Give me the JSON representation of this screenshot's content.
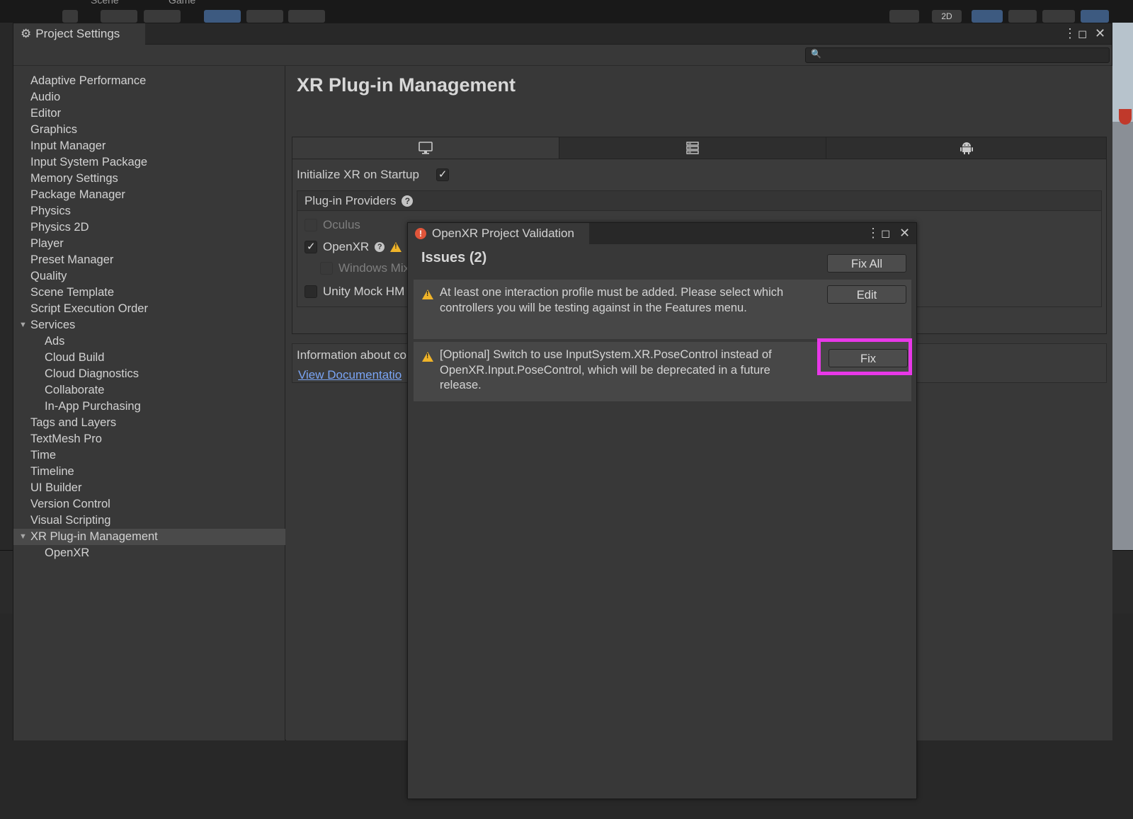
{
  "editor": {
    "tabs": [
      "Scene",
      "Game"
    ],
    "toolbar_2d": "2D"
  },
  "project_settings": {
    "title": "Project Settings",
    "search": {
      "placeholder": ""
    },
    "sidebar": [
      {
        "label": "Adaptive Performance",
        "level": 0
      },
      {
        "label": "Audio",
        "level": 0
      },
      {
        "label": "Editor",
        "level": 0
      },
      {
        "label": "Graphics",
        "level": 0
      },
      {
        "label": "Input Manager",
        "level": 0
      },
      {
        "label": "Input System Package",
        "level": 0
      },
      {
        "label": "Memory Settings",
        "level": 0
      },
      {
        "label": "Package Manager",
        "level": 0
      },
      {
        "label": "Physics",
        "level": 0
      },
      {
        "label": "Physics 2D",
        "level": 0
      },
      {
        "label": "Player",
        "level": 0
      },
      {
        "label": "Preset Manager",
        "level": 0
      },
      {
        "label": "Quality",
        "level": 0
      },
      {
        "label": "Scene Template",
        "level": 0
      },
      {
        "label": "Script Execution Order",
        "level": 0
      },
      {
        "label": "Services",
        "level": 0,
        "expanded": true
      },
      {
        "label": "Ads",
        "level": 1
      },
      {
        "label": "Cloud Build",
        "level": 1
      },
      {
        "label": "Cloud Diagnostics",
        "level": 1
      },
      {
        "label": "Collaborate",
        "level": 1
      },
      {
        "label": "In-App Purchasing",
        "level": 1
      },
      {
        "label": "Tags and Layers",
        "level": 0
      },
      {
        "label": "TextMesh Pro",
        "level": 0
      },
      {
        "label": "Time",
        "level": 0
      },
      {
        "label": "Timeline",
        "level": 0
      },
      {
        "label": "UI Builder",
        "level": 0
      },
      {
        "label": "Version Control",
        "level": 0
      },
      {
        "label": "Visual Scripting",
        "level": 0
      },
      {
        "label": "XR Plug-in Management",
        "level": 0,
        "expanded": true,
        "selected": true
      },
      {
        "label": "OpenXR",
        "level": 1
      }
    ],
    "content": {
      "title": "XR Plug-in Management",
      "platform_tabs": [
        "desktop-icon",
        "server-icon",
        "android-icon"
      ],
      "init_label": "Initialize XR on Startup",
      "init_checked": true,
      "providers_title": "Plug-in Providers",
      "providers": [
        {
          "label": "Oculus",
          "checked": false,
          "disabled": true
        },
        {
          "label": "OpenXR",
          "checked": true,
          "warning": true
        },
        {
          "label": "Windows Mix",
          "checked": false,
          "disabled": true,
          "indent": true
        },
        {
          "label": "Unity Mock HM",
          "checked": false
        }
      ],
      "info_text": "Information about co",
      "doc_link": "View Documentatio"
    }
  },
  "validation": {
    "title": "OpenXR Project Validation",
    "issues_title": "Issues (2)",
    "fix_all_label": "Fix All",
    "issues": [
      {
        "text": "At least one interaction profile must be added.  Please select which controllers you will be testing against in the Features menu.",
        "button": "Edit"
      },
      {
        "text": "[Optional] Switch to use InputSystem.XR.PoseControl instead of OpenXR.Input.PoseControl, which will be deprecated in a future release.",
        "button": "Fix"
      }
    ]
  },
  "colors": {
    "highlight": "#e838e8",
    "warning": "#f0b429",
    "error": "#e0553a",
    "link": "#7aa5f5"
  }
}
